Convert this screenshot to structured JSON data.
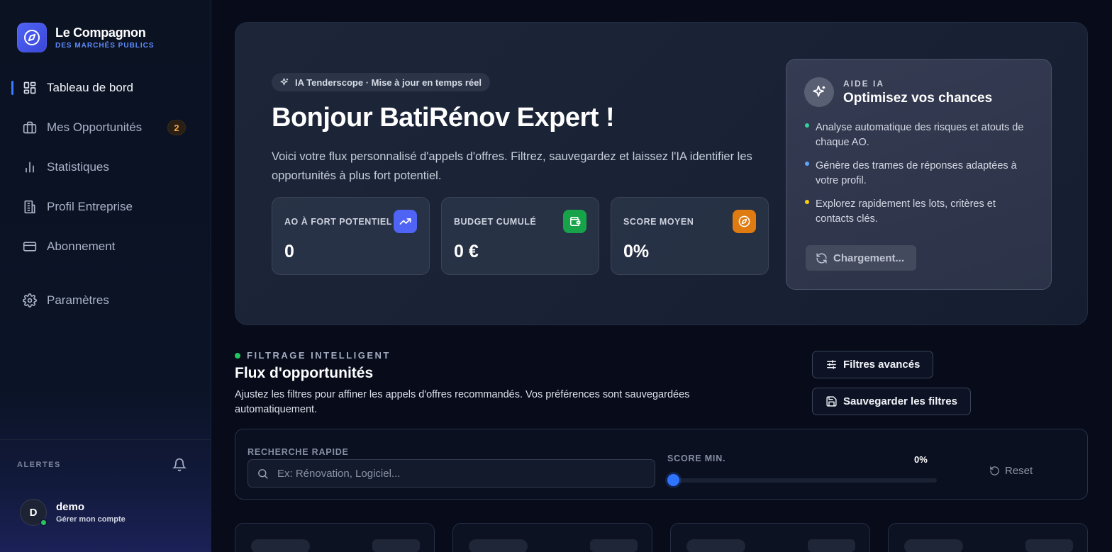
{
  "brand": {
    "title": "Le Compagnon",
    "subtitle": "DES MARCHÉS PUBLICS"
  },
  "sidebar": {
    "items": [
      {
        "label": "Tableau de bord",
        "icon": "dashboard-icon",
        "active": true
      },
      {
        "label": "Mes Opportunités",
        "icon": "briefcase-icon",
        "badge": "2"
      },
      {
        "label": "Statistiques",
        "icon": "bar-chart-icon"
      },
      {
        "label": "Profil Entreprise",
        "icon": "building-icon"
      },
      {
        "label": "Abonnement",
        "icon": "credit-card-icon"
      },
      {
        "label": "Paramètres",
        "icon": "gear-icon"
      }
    ],
    "alerts_label": "ALERTES",
    "user": {
      "initial": "D",
      "name": "demo",
      "link": "Gérer mon compte",
      "status_color": "#22c55e"
    }
  },
  "hero": {
    "pill": "IA Tenderscope · Mise à  jour en temps réel",
    "title": "Bonjour BatiRénov Expert !",
    "description": "Voici votre flux personnalisé d'appels d'offres. Filtrez, sauvegardez et laissez l'IA identifier les opportunités à  plus fort potentiel.",
    "kpis": [
      {
        "label": "AO À  FORT POTENTIEL",
        "value": "0",
        "icon": "trending-up-icon",
        "color": "#4f63f5"
      },
      {
        "label": "BUDGET CUMULÉ",
        "value": "0 €",
        "icon": "wallet-icon",
        "color": "#16a34a"
      },
      {
        "label": "SCORE MOYEN",
        "value": "0%",
        "icon": "compass-icon",
        "color": "#e07b12"
      }
    ]
  },
  "ai_card": {
    "kicker": "AIDE IA",
    "title": "Optimisez vos chances",
    "items": [
      {
        "text": "Analyse automatique des risques et atouts de chaque AO.",
        "color": "#34d399"
      },
      {
        "text": "Génère des trames de réponses adaptées à votre profil.",
        "color": "#60a5fa"
      },
      {
        "text": "Explorez rapidement les lots, critères et contacts clés.",
        "color": "#facc15"
      }
    ],
    "loading_label": "Chargement..."
  },
  "filters": {
    "kicker": "FILTRAGE INTELLIGENT",
    "title": "Flux d'opportunités",
    "description": "Ajustez les filtres pour affiner les appels d'offres recommandés. Vos préférences sont sauvegardées automatiquement.",
    "advanced_label": "Filtres avancés",
    "save_label": "Sauvegarder les filtres",
    "search_label": "RECHERCHE RAPIDE",
    "search_placeholder": "Ex: Rénovation, Logiciel...",
    "search_value": "",
    "score_label": "SCORE MIN.",
    "score_value": "0%",
    "score_min": 0,
    "reset_label": "Reset"
  },
  "colors": {
    "accent": "#3b7bff",
    "background": "#070b1a"
  }
}
